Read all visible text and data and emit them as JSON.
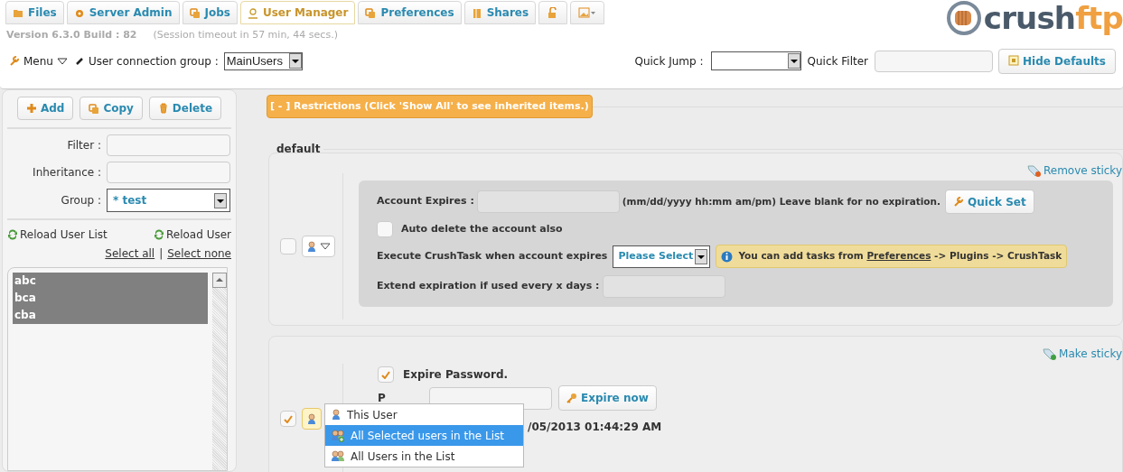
{
  "tabs": [
    {
      "label": "Files",
      "selected": false
    },
    {
      "label": "Server Admin",
      "selected": false
    },
    {
      "label": "Jobs",
      "selected": false
    },
    {
      "label": "User Manager",
      "selected": true
    },
    {
      "label": "Preferences",
      "selected": false
    },
    {
      "label": "Shares",
      "selected": false
    }
  ],
  "logo": {
    "main": "crush",
    "accent": "ftp"
  },
  "version": "Version 6.3.0 Build : 82",
  "session": "(Session timeout in 57 min, 44 secs.)",
  "toolbar": {
    "menu": "Menu",
    "connection_group_label": "User connection group :",
    "connection_group": "MainUsers",
    "quick_jump_label": "Quick Jump :",
    "quick_filter_label": "Quick Filter",
    "hide_defaults": "Hide Defaults"
  },
  "sidebar": {
    "buttons": [
      "Add",
      "Copy",
      "Delete"
    ],
    "filter_label": "Filter :",
    "inheritance_label": "Inheritance :",
    "group_label": "Group :",
    "group_value": "* test",
    "reload_list": "Reload User List",
    "reload_user": "Reload User",
    "select_all": "Select all",
    "select_separator": "|",
    "select_none": "Select none",
    "users": [
      {
        "name": "abc",
        "selected": true
      },
      {
        "name": "bca",
        "selected": true
      },
      {
        "name": "cba",
        "selected": true
      }
    ]
  },
  "restrictions": {
    "legend": "[ - ] Restrictions (Click 'Show All' to see inherited items.)",
    "expiration_section": {
      "title": "default",
      "checked": false,
      "menu_open": false,
      "sticky_link": "Remove sticky",
      "account_expires_label": "Account Expires :",
      "format_hint": "(mm/dd/yyyy hh:mm am/pm) Leave blank for no expiration.",
      "quick_set": "Quick Set",
      "auto_delete": {
        "label": "Auto delete the account also",
        "checked": false
      },
      "crushtask_label": "Execute CrushTask when account expires",
      "crushtask_value": "Please Select",
      "info_before": "You can add tasks from",
      "info_link": "Preferences",
      "info_after": "-> Plugins -> CrushTask",
      "extend_label": "Extend expiration if used every x days :"
    },
    "password_section": {
      "checked": true,
      "menu_open": true,
      "sticky_link": "Make sticky",
      "expire_password": {
        "label": "Expire Password.",
        "checked": true
      },
      "password_label": "P",
      "expire_now": "Expire now",
      "expiry_date": "/05/2013 01:44:29 AM",
      "scope_menu": [
        {
          "label": "This User",
          "selected": false
        },
        {
          "label": "All Selected users in the List",
          "selected": true
        },
        {
          "label": "All Users in the List",
          "selected": false
        }
      ]
    }
  }
}
